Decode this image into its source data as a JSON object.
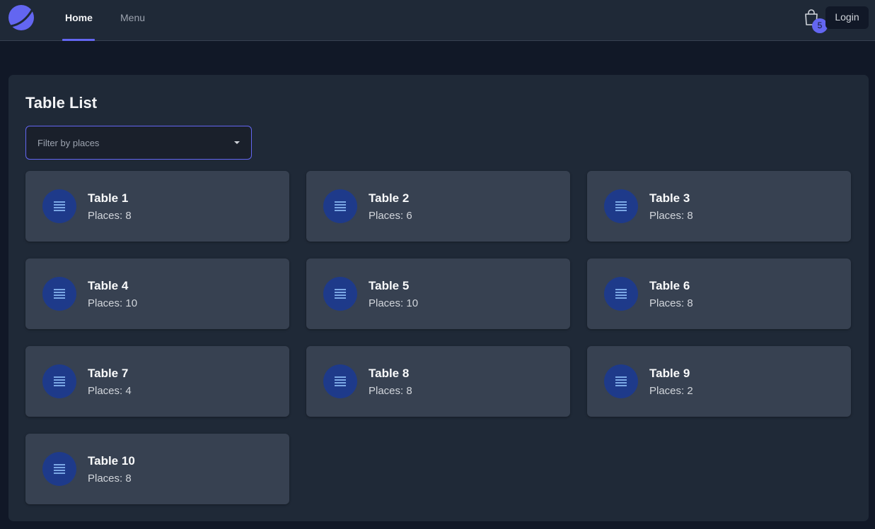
{
  "nav": {
    "links": [
      {
        "label": "Home",
        "active": true
      },
      {
        "label": "Menu",
        "active": false
      }
    ],
    "cart_count": "5",
    "login_label": "Login"
  },
  "page": {
    "title": "Table List",
    "filter_placeholder": "Filter by places"
  },
  "tables": [
    {
      "name": "Table 1",
      "places": "Places: 8"
    },
    {
      "name": "Table 2",
      "places": "Places: 6"
    },
    {
      "name": "Table 3",
      "places": "Places: 8"
    },
    {
      "name": "Table 4",
      "places": "Places: 10"
    },
    {
      "name": "Table 5",
      "places": "Places: 10"
    },
    {
      "name": "Table 6",
      "places": "Places: 8"
    },
    {
      "name": "Table 7",
      "places": "Places: 4"
    },
    {
      "name": "Table 8",
      "places": "Places: 8"
    },
    {
      "name": "Table 9",
      "places": "Places: 2"
    },
    {
      "name": "Table 10",
      "places": "Places: 8"
    }
  ],
  "icons": {
    "logo": "logo-icon",
    "cart": "shopping-bag-icon",
    "table": "list-icon",
    "dropdown": "chevron-down-icon"
  },
  "colors": {
    "accent": "#6366f1",
    "icon_circle": "#1e3a8a",
    "card": "#374151"
  }
}
